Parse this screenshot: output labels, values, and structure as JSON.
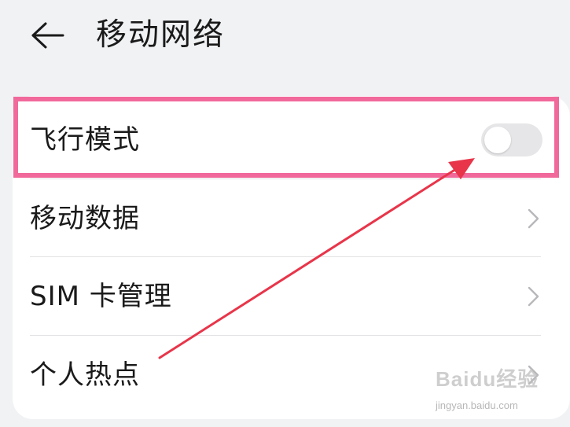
{
  "header": {
    "title": "移动网络",
    "back_icon": "arrow-left-icon"
  },
  "settings": {
    "airplane_mode": {
      "label": "飞行模式",
      "enabled": false
    },
    "mobile_data": {
      "label": "移动数据",
      "icon": "chevron-right-icon"
    },
    "sim_management": {
      "label": "SIM 卡管理",
      "icon": "chevron-right-icon"
    },
    "hotspot": {
      "label": "个人热点",
      "icon": "chevron-right-icon"
    }
  },
  "annotation": {
    "highlight_color": "#f0699a",
    "arrow_color": "#e8354a"
  },
  "watermark": {
    "logo": "Baidu经验",
    "url": "jingyan.baidu.com"
  },
  "colors": {
    "background": "#f1f2f4",
    "card": "#ffffff",
    "text": "#1a1a1a",
    "toggle_off": "#e6e6e8"
  }
}
